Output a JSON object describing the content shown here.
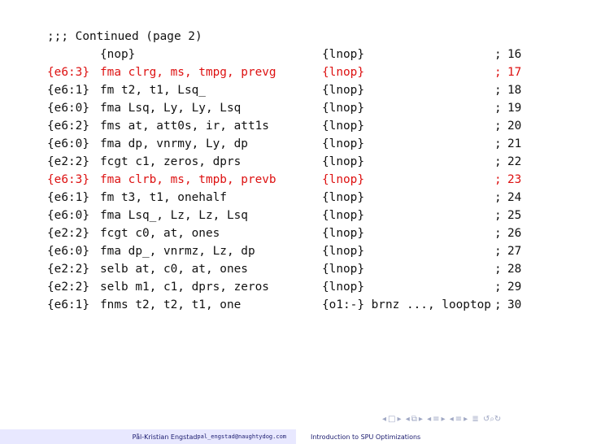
{
  "header_comment": ";;; Continued (page 2)",
  "rows": [
    {
      "reg": "",
      "ins": "{nop}",
      "odd": "{lnop}",
      "semi": ";",
      "num": "16",
      "highlight": false
    },
    {
      "reg": "{e6:3}",
      "ins": "fma clrg, ms, tmpg, prevg",
      "odd": "{lnop}",
      "semi": ";",
      "num": "17",
      "highlight": true
    },
    {
      "reg": "{e6:1}",
      "ins": "fm t2, t1, Lsq_",
      "odd": "{lnop}",
      "semi": ";",
      "num": "18",
      "highlight": false
    },
    {
      "reg": "{e6:0}",
      "ins": "fma Lsq, Ly, Ly, Lsq",
      "odd": "{lnop}",
      "semi": ";",
      "num": "19",
      "highlight": false
    },
    {
      "reg": "{e6:2}",
      "ins": "fms at, att0s, ir, att1s",
      "odd": "{lnop}",
      "semi": ";",
      "num": "20",
      "highlight": false
    },
    {
      "reg": "{e6:0}",
      "ins": "fma dp, vnrmy, Ly, dp",
      "odd": "{lnop}",
      "semi": ";",
      "num": "21",
      "highlight": false
    },
    {
      "reg": "{e2:2}",
      "ins": "fcgt c1, zeros, dprs",
      "odd": "{lnop}",
      "semi": ";",
      "num": "22",
      "highlight": false
    },
    {
      "reg": "{e6:3}",
      "ins": "fma clrb, ms, tmpb, prevb",
      "odd": "{lnop}",
      "semi": ";",
      "num": "23",
      "highlight": true
    },
    {
      "reg": "{e6:1}",
      "ins": "fm t3, t1, onehalf",
      "odd": "{lnop}",
      "semi": ";",
      "num": "24",
      "highlight": false
    },
    {
      "reg": "{e6:0}",
      "ins": "fma Lsq_, Lz, Lz, Lsq",
      "odd": "{lnop}",
      "semi": ";",
      "num": "25",
      "highlight": false
    },
    {
      "reg": "{e2:2}",
      "ins": "fcgt c0, at, ones",
      "odd": "{lnop}",
      "semi": ";",
      "num": "26",
      "highlight": false
    },
    {
      "reg": "{e6:0}",
      "ins": "fma dp_, vnrmz, Lz, dp",
      "odd": "{lnop}",
      "semi": ";",
      "num": "27",
      "highlight": false
    },
    {
      "reg": "{e2:2}",
      "ins": "selb at, c0, at, ones",
      "odd": "{lnop}",
      "semi": ";",
      "num": "28",
      "highlight": false
    },
    {
      "reg": "{e2:2}",
      "ins": "selb m1, c1, dprs, zeros",
      "odd": "{lnop}",
      "semi": ";",
      "num": "29",
      "highlight": false
    },
    {
      "reg": "{e6:1}",
      "ins": "fnms t2, t2, t1, one",
      "odd": "{o1:-} brnz ..., looptop",
      "semi": ";",
      "num": "30",
      "highlight": false
    }
  ],
  "footer": {
    "author": "Pål-Kristian Engstad",
    "email": "pal_engstad@naughtydog.com",
    "title": "Introduction to SPU Optimizations"
  },
  "nav_icons": [
    "frame-prev-icon",
    "frame-next-icon",
    "subsection-prev-icon",
    "subsection-next-icon",
    "section-prev-icon",
    "section-next-icon",
    "slide-prev-icon",
    "slide-next-icon",
    "align-icon",
    "search-loop-icon"
  ]
}
